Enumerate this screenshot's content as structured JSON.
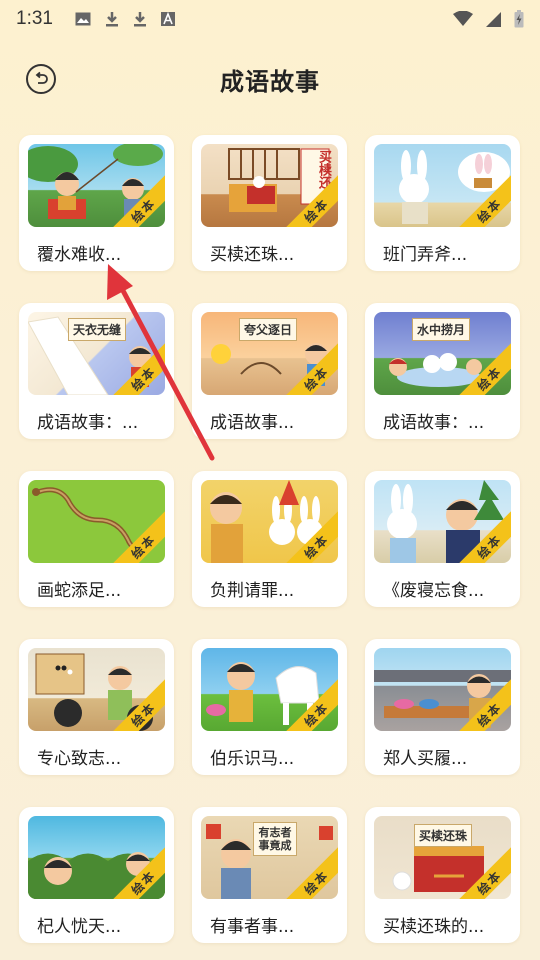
{
  "status_bar": {
    "time": "1:31",
    "left_icons": [
      "image-icon",
      "download-icon",
      "download-icon",
      "font-icon"
    ],
    "right_icons": [
      "wifi-icon",
      "signal-icon",
      "battery-charging-icon"
    ]
  },
  "header": {
    "title": "成语故事",
    "back_icon": "back-icon"
  },
  "ribbon_label": "绘本",
  "cards": [
    {
      "title": "覆水难收...",
      "thumb_label": ""
    },
    {
      "title": "买椟还珠...",
      "thumb_label": "买椟还"
    },
    {
      "title": "班门弄斧...",
      "thumb_label": ""
    },
    {
      "title": "成语故事：...",
      "thumb_label": "天衣无缝"
    },
    {
      "title": "成语故事...",
      "thumb_label": "夸父逐日"
    },
    {
      "title": "成语故事：...",
      "thumb_label": "水中捞月"
    },
    {
      "title": "画蛇添足...",
      "thumb_label": ""
    },
    {
      "title": "负荆请罪...",
      "thumb_label": ""
    },
    {
      "title": "《废寝忘食...",
      "thumb_label": ""
    },
    {
      "title": "专心致志...",
      "thumb_label": ""
    },
    {
      "title": "伯乐识马...",
      "thumb_label": ""
    },
    {
      "title": "郑人买履...",
      "thumb_label": ""
    },
    {
      "title": "杞人忧天...",
      "thumb_label": ""
    },
    {
      "title": "有事者事...",
      "thumb_label": "有志者事竟成"
    },
    {
      "title": "买椟还珠的...",
      "thumb_label": "买椟还珠"
    }
  ],
  "colors": {
    "ribbon": "#f4c21a",
    "arrow": "#e0343b",
    "background": "#fdf1cf"
  }
}
